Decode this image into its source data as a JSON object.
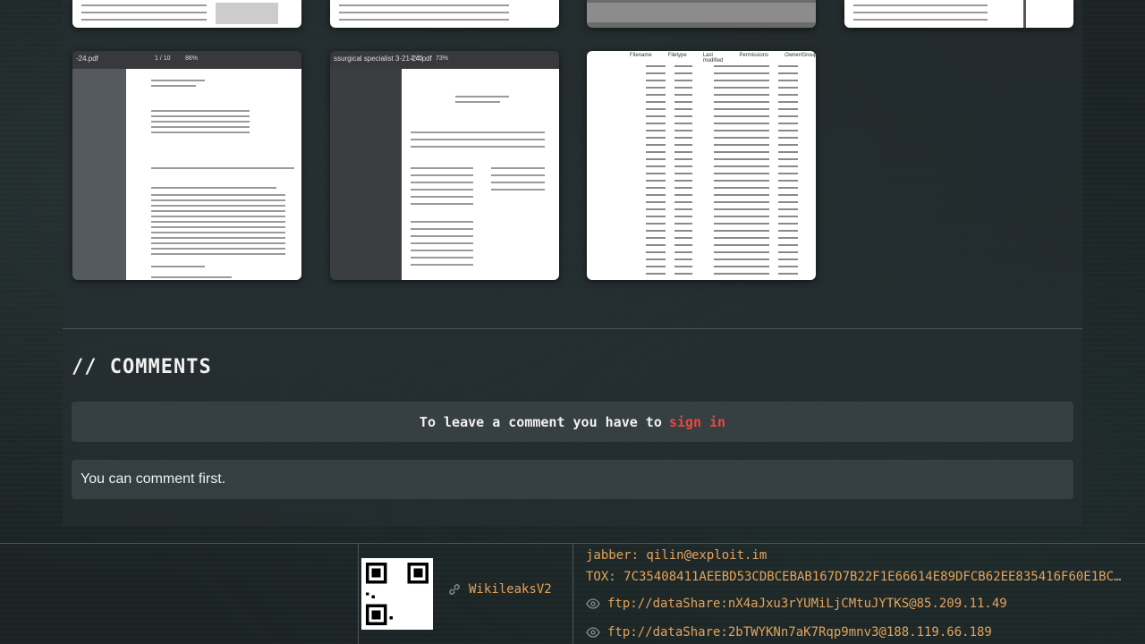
{
  "comments": {
    "title": "// COMMENTS",
    "signin_prompt": "To leave a comment you have to",
    "signin_link": "sign in",
    "empty_message": "You can comment first."
  },
  "thumbnails": {
    "row2": [
      {
        "tab_title": "-24.pdf",
        "page": "1 / 10",
        "zoom": "86%"
      },
      {
        "tab_title": "ssurgical specialist 3-21-24.pdf",
        "page": "2 / 5",
        "zoom": "73%"
      },
      {
        "tab_title": "",
        "columns": [
          "Filename",
          "Filetype",
          "Last modified",
          "Permissions",
          "Owner/Group"
        ]
      }
    ]
  },
  "footer": {
    "wiki_label": "WikileaksV2",
    "jabber": "jabber: qilin@exploit.im",
    "tox": "TOX: 7C35408411AEEBD53CDBCEBAB167D7B22F1E66614E89DFCB62EE835416F60E1BC…",
    "ftp1": "ftp://dataShare:nX4aJxu3rYUMiLjCMtuJYTKS@85.209.11.49",
    "ftp2": "ftp://dataShare:2bTWYKNn7aK7Rqp9mnv3@188.119.66.189"
  },
  "colors": {
    "accent": "#e3a35a",
    "link_red": "#e8493f"
  }
}
